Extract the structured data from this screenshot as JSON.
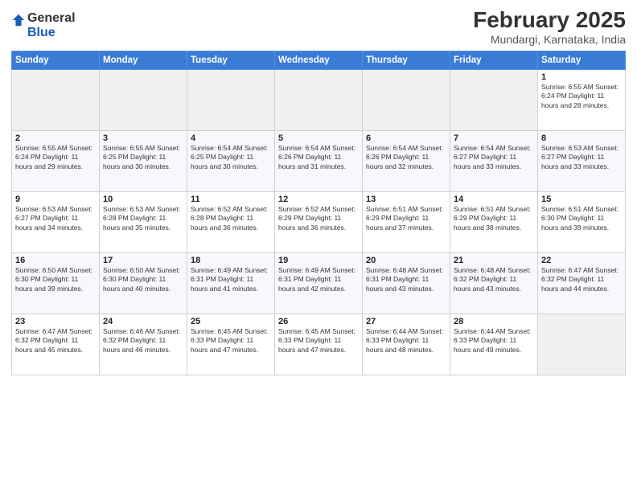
{
  "logo": {
    "general": "General",
    "blue": "Blue"
  },
  "title": "February 2025",
  "location": "Mundargi, Karnataka, India",
  "days_of_week": [
    "Sunday",
    "Monday",
    "Tuesday",
    "Wednesday",
    "Thursday",
    "Friday",
    "Saturday"
  ],
  "weeks": [
    [
      {
        "day": "",
        "info": ""
      },
      {
        "day": "",
        "info": ""
      },
      {
        "day": "",
        "info": ""
      },
      {
        "day": "",
        "info": ""
      },
      {
        "day": "",
        "info": ""
      },
      {
        "day": "",
        "info": ""
      },
      {
        "day": "1",
        "info": "Sunrise: 6:55 AM\nSunset: 6:24 PM\nDaylight: 11 hours\nand 28 minutes."
      }
    ],
    [
      {
        "day": "2",
        "info": "Sunrise: 6:55 AM\nSunset: 6:24 PM\nDaylight: 11 hours\nand 29 minutes."
      },
      {
        "day": "3",
        "info": "Sunrise: 6:55 AM\nSunset: 6:25 PM\nDaylight: 11 hours\nand 30 minutes."
      },
      {
        "day": "4",
        "info": "Sunrise: 6:54 AM\nSunset: 6:25 PM\nDaylight: 11 hours\nand 30 minutes."
      },
      {
        "day": "5",
        "info": "Sunrise: 6:54 AM\nSunset: 6:26 PM\nDaylight: 11 hours\nand 31 minutes."
      },
      {
        "day": "6",
        "info": "Sunrise: 6:54 AM\nSunset: 6:26 PM\nDaylight: 11 hours\nand 32 minutes."
      },
      {
        "day": "7",
        "info": "Sunrise: 6:54 AM\nSunset: 6:27 PM\nDaylight: 11 hours\nand 33 minutes."
      },
      {
        "day": "8",
        "info": "Sunrise: 6:53 AM\nSunset: 6:27 PM\nDaylight: 11 hours\nand 33 minutes."
      }
    ],
    [
      {
        "day": "9",
        "info": "Sunrise: 6:53 AM\nSunset: 6:27 PM\nDaylight: 11 hours\nand 34 minutes."
      },
      {
        "day": "10",
        "info": "Sunrise: 6:53 AM\nSunset: 6:28 PM\nDaylight: 11 hours\nand 35 minutes."
      },
      {
        "day": "11",
        "info": "Sunrise: 6:52 AM\nSunset: 6:28 PM\nDaylight: 11 hours\nand 36 minutes."
      },
      {
        "day": "12",
        "info": "Sunrise: 6:52 AM\nSunset: 6:29 PM\nDaylight: 11 hours\nand 36 minutes."
      },
      {
        "day": "13",
        "info": "Sunrise: 6:51 AM\nSunset: 6:29 PM\nDaylight: 11 hours\nand 37 minutes."
      },
      {
        "day": "14",
        "info": "Sunrise: 6:51 AM\nSunset: 6:29 PM\nDaylight: 11 hours\nand 38 minutes."
      },
      {
        "day": "15",
        "info": "Sunrise: 6:51 AM\nSunset: 6:30 PM\nDaylight: 11 hours\nand 39 minutes."
      }
    ],
    [
      {
        "day": "16",
        "info": "Sunrise: 6:50 AM\nSunset: 6:30 PM\nDaylight: 11 hours\nand 39 minutes."
      },
      {
        "day": "17",
        "info": "Sunrise: 6:50 AM\nSunset: 6:30 PM\nDaylight: 11 hours\nand 40 minutes."
      },
      {
        "day": "18",
        "info": "Sunrise: 6:49 AM\nSunset: 6:31 PM\nDaylight: 11 hours\nand 41 minutes."
      },
      {
        "day": "19",
        "info": "Sunrise: 6:49 AM\nSunset: 6:31 PM\nDaylight: 11 hours\nand 42 minutes."
      },
      {
        "day": "20",
        "info": "Sunrise: 6:48 AM\nSunset: 6:31 PM\nDaylight: 11 hours\nand 43 minutes."
      },
      {
        "day": "21",
        "info": "Sunrise: 6:48 AM\nSunset: 6:32 PM\nDaylight: 11 hours\nand 43 minutes."
      },
      {
        "day": "22",
        "info": "Sunrise: 6:47 AM\nSunset: 6:32 PM\nDaylight: 11 hours\nand 44 minutes."
      }
    ],
    [
      {
        "day": "23",
        "info": "Sunrise: 6:47 AM\nSunset: 6:32 PM\nDaylight: 11 hours\nand 45 minutes."
      },
      {
        "day": "24",
        "info": "Sunrise: 6:46 AM\nSunset: 6:32 PM\nDaylight: 11 hours\nand 46 minutes."
      },
      {
        "day": "25",
        "info": "Sunrise: 6:45 AM\nSunset: 6:33 PM\nDaylight: 11 hours\nand 47 minutes."
      },
      {
        "day": "26",
        "info": "Sunrise: 6:45 AM\nSunset: 6:33 PM\nDaylight: 11 hours\nand 47 minutes."
      },
      {
        "day": "27",
        "info": "Sunrise: 6:44 AM\nSunset: 6:33 PM\nDaylight: 11 hours\nand 48 minutes."
      },
      {
        "day": "28",
        "info": "Sunrise: 6:44 AM\nSunset: 6:33 PM\nDaylight: 11 hours\nand 49 minutes."
      },
      {
        "day": "",
        "info": ""
      }
    ]
  ]
}
